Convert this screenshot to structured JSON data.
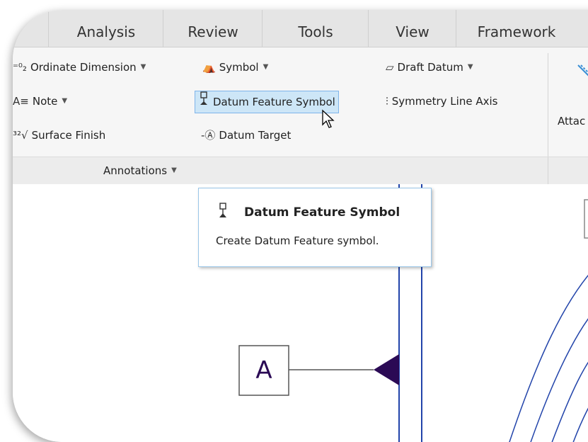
{
  "tabs": [
    "Analysis",
    "Review",
    "Tools",
    "View",
    "Framework"
  ],
  "ribbon": {
    "ordinate_dimension": "Ordinate Dimension",
    "symbol": "Symbol",
    "draft_datum": "Draft Datum",
    "note": "Note",
    "datum_feature_symbol": "Datum Feature Symbol",
    "symmetry_line_axis": "Symmetry Line Axis",
    "surface_finish": "Surface Finish",
    "datum_target": "Datum Target",
    "attach_partial": "Attac",
    "group_label": "Annotations"
  },
  "tooltip": {
    "title": "Datum Feature Symbol",
    "description": "Create Datum Feature symbol."
  },
  "canvas": {
    "datum_letter": "A"
  },
  "colors": {
    "highlight": "#cde6f7",
    "datum_blue": "#2244aa",
    "datum_purple": "#2b0a55"
  }
}
